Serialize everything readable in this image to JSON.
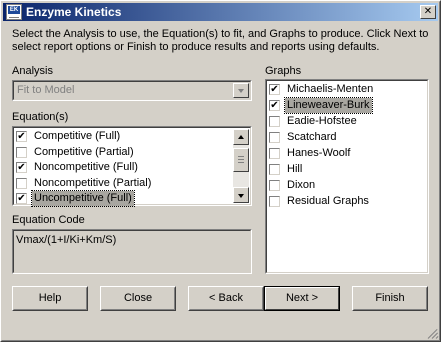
{
  "window": {
    "title": "Enzyme Kinetics",
    "icon_text": "EK",
    "close_glyph": "✕"
  },
  "instructions": "Select the Analysis to use, the Equation(s) to fit, and Graphs to produce.  Click Next to select report options or Finish to produce results and reports using defaults.",
  "analysis": {
    "label": "Analysis",
    "value": "Fit to Model"
  },
  "equations": {
    "label": "Equation(s)",
    "items": [
      {
        "label": "Competitive (Full)",
        "checked": true
      },
      {
        "label": "Competitive (Partial)",
        "checked": false
      },
      {
        "label": "Noncompetitive (Full)",
        "checked": true
      },
      {
        "label": "Noncompetitive (Partial)",
        "checked": false
      },
      {
        "label": "Uncompetitive (Full)",
        "checked": true
      }
    ]
  },
  "equation_code": {
    "label": "Equation Code",
    "value": "Vmax/(1+I/Ki+Km/S)"
  },
  "graphs": {
    "label": "Graphs",
    "items": [
      {
        "label": "Michaelis-Menten",
        "checked": true
      },
      {
        "label": "Lineweaver-Burk",
        "checked": true
      },
      {
        "label": "Eadie-Hofstee",
        "checked": false
      },
      {
        "label": "Scatchard",
        "checked": false
      },
      {
        "label": "Hanes-Woolf",
        "checked": false
      },
      {
        "label": "Hill",
        "checked": false
      },
      {
        "label": "Dixon",
        "checked": false
      },
      {
        "label": "Residual Graphs",
        "checked": false
      }
    ]
  },
  "buttons": {
    "help": "Help",
    "close": "Close",
    "back": "< Back",
    "next": "Next >",
    "finish": "Finish"
  },
  "check_glyph": "✔"
}
